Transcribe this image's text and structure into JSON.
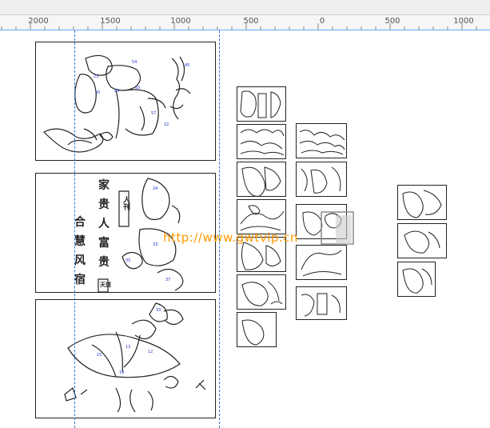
{
  "ruler": {
    "labels": [
      "2000",
      "1500",
      "1000",
      "500",
      "0",
      "500",
      "1000"
    ]
  },
  "watermark": "http://www.gwtvip.cn",
  "panel_text": {
    "couplet_left": [
      "家",
      "贵",
      "人",
      "富",
      "贵"
    ],
    "couplet_mid": [
      "合",
      "慧",
      "风",
      "宿"
    ],
    "seal_top": "人刊",
    "seal_bottom": "天道",
    "fu": "福"
  },
  "colors": {
    "guide_blue": "#2a7ad6",
    "watermark": "#ff9900",
    "outline": "#222222",
    "label_blue": "#2233cc"
  }
}
